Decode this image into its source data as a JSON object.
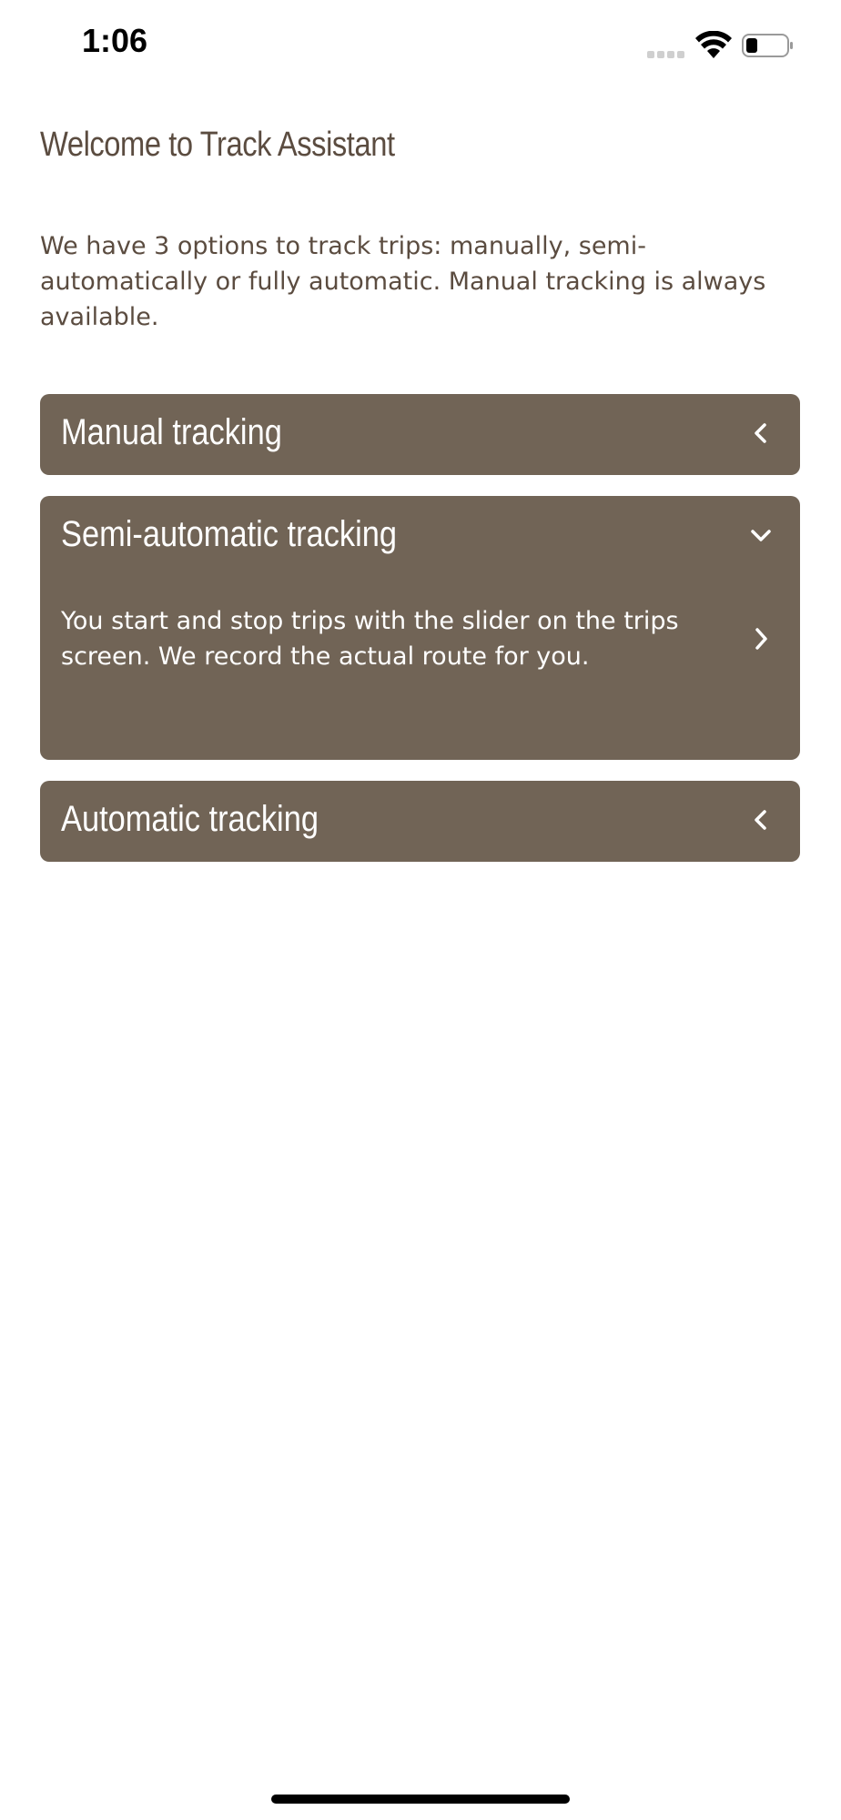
{
  "status_bar": {
    "time": "1:06",
    "wifi_icon": "wifi-icon",
    "battery_icon": "battery-icon",
    "signal_icon": "cellular-signal-icon"
  },
  "page": {
    "title": "Welcome to Track Assistant",
    "intro": "We have 3 options to track trips: manually, semi-automatically or fully automatic. Manual tracking is always available."
  },
  "options": [
    {
      "title": "Manual tracking",
      "expanded": false,
      "chevron_icon": "chevron-left-icon"
    },
    {
      "title": "Semi-automatic tracking",
      "expanded": true,
      "chevron_icon": "chevron-down-icon",
      "description": "You start and stop trips with the slider on the trips screen. We record the actual route for you.",
      "description_icon": "chevron-right-icon"
    },
    {
      "title": "Automatic tracking",
      "expanded": false,
      "chevron_icon": "chevron-left-icon"
    }
  ],
  "colors": {
    "panel": "#716456",
    "text_brown": "#5b4c40",
    "panel_text": "#ffffff"
  }
}
